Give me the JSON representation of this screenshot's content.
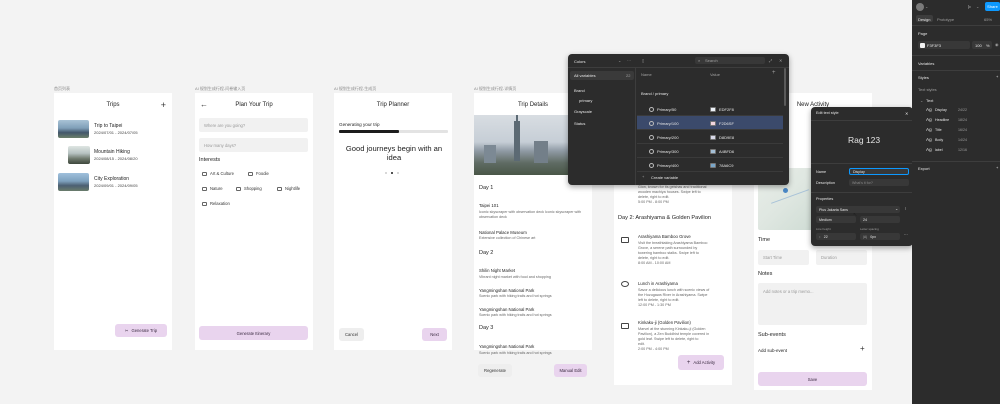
{
  "frame_labels": [
    "首页列表",
    "AI 规划生成行程-问卷输入页",
    "AI 规划生成行程-生成页",
    "AI 规划生成行程-详情页",
    "AI 规划生成行程-编辑页"
  ],
  "screen_trips": {
    "title": "Trips",
    "add_icon": "plus-icon",
    "trips": [
      {
        "name": "Trip to Taipei",
        "dates": "2024/07/01 - 2024/07/05"
      },
      {
        "name": "Mountain Hiking",
        "dates": "2024/08/15 - 2024/08/20"
      },
      {
        "name": "City Exploration",
        "dates": "2024/09/01 - 2024/09/05"
      }
    ],
    "generate_button": "Generate Trip"
  },
  "screen_plan": {
    "title": "Plan Your Trip",
    "destination_placeholder": "Where are you going?",
    "days_placeholder": "How many days?",
    "interests_heading": "Interests",
    "interests": [
      "Art & Culture",
      "Foodie",
      "Nature",
      "Shopping",
      "Nightlife",
      "Relaxation"
    ],
    "generate_button": "Generate Itinerary"
  },
  "screen_planner": {
    "title": "Trip Planner",
    "status": "Generating your trip",
    "progress": 0.55,
    "message": "Good journeys begin with an idea",
    "cancel_button": "Cancel",
    "next_button": "Next"
  },
  "screen_details": {
    "title": "Trip Details",
    "days": [
      {
        "label": "Day 1",
        "items": [
          {
            "title": "Taipei 101",
            "desc": "Iconic skyscraper with observation deck Iconic skyscraper with observation deck"
          },
          {
            "title": "National Palace Museum",
            "desc": "Extensive collection of Chinese art"
          }
        ]
      },
      {
        "label": "Day 2",
        "items": [
          {
            "title": "Shilin Night Market",
            "desc": "Vibrant night market with food and shopping"
          },
          {
            "title": "Yangmingshan National Park",
            "desc": "Scenic park with hiking trails and hot springs"
          },
          {
            "title": "Yangmingshan National Park",
            "desc": "Scenic park with hiking trails and hot springs"
          }
        ]
      },
      {
        "label": "Day 3",
        "items": [
          {
            "title": "Yangmingshan National Park",
            "desc": "Scenic park with hiking trails and hot springs"
          }
        ]
      }
    ],
    "regenerate_button": "Regenerate",
    "manual_edit_button": "Manual Edit"
  },
  "screen_edit": {
    "top_lines": [
      "Gion, known for its geishas and traditional",
      "wooden machiya houses. Swipe left to",
      "delete, right to edit.",
      "5:00 PM - 8:00 PM"
    ],
    "day2_heading": "Day 2: Arashiyama & Golden Pavilion",
    "activities": [
      {
        "icon": "forest-icon",
        "title": "Arashiyama Bamboo Grove",
        "lines": [
          "Visit the breathtaking Arashiyama Bamboo",
          "Grove, a serene path surrounded by",
          "towering bamboo stalks. Swipe left to",
          "delete, right to edit."
        ],
        "time": "8:00 AM - 10:00 AM"
      },
      {
        "icon": "restaurant-icon",
        "title": "Lunch in Arashiyama",
        "lines": [
          "Savor a delicious lunch with scenic views of",
          "the Hozugawa River in Arashiyama. Swipe",
          "left to delete, right to edit."
        ],
        "time": "12:00 PM - 1:30 PM"
      },
      {
        "icon": "temple-icon",
        "title": "Kinkaku-ji (Golden Pavilion)",
        "lines": [
          "Marvel at the stunning Kinkaku-ji (Golden",
          "Pavilion), a Zen Buddhist temple covered in",
          "gold leaf. Swipe left to delete, right to",
          "edit."
        ],
        "time": "2:00 PM - 4:00 PM"
      }
    ],
    "add_activity_button": "Add Activity"
  },
  "screen_new": {
    "title": "New Activity",
    "time_heading": "Time",
    "start_placeholder": "Start Time",
    "duration_placeholder": "Duration",
    "notes_heading": "Notes",
    "notes_placeholder": "Add notes or a trip memo...",
    "subevents_heading": "Sub-events",
    "add_subevent": "Add sub-event",
    "save_button": "Save"
  },
  "variables_panel": {
    "collection": "Colors",
    "search_placeholder": "Search",
    "side": {
      "all_label": "All variables",
      "all_count": "22",
      "groups": [
        "Brand",
        "primary",
        "Grayscale",
        "Status"
      ]
    },
    "col_name": "Name",
    "col_value": "Value",
    "path": "Brand / primary",
    "rows": [
      {
        "name": "Primary/50",
        "value": "EDF2F8",
        "color": "#EDF2F8",
        "selected": false
      },
      {
        "name": "Primary/100",
        "value": "F2D6SF",
        "color": "#F2D6DF",
        "selected": true
      },
      {
        "name": "Primary/200",
        "value": "D8D9E8",
        "color": "#D8D9E8",
        "selected": false
      },
      {
        "name": "Primary/300",
        "value": "A4BFD6",
        "color": "#A4BFD6",
        "selected": false
      },
      {
        "name": "Primary/400",
        "value": "78A6C9",
        "color": "#78A6C9",
        "selected": false
      }
    ],
    "create_label": "Create variable"
  },
  "text_style_popup": {
    "title": "Edit text style",
    "preview": "Rag 123",
    "name_label": "Name",
    "name_value": "Display",
    "description_label": "Description",
    "description_placeholder": "What's it for?",
    "properties_heading": "Properties",
    "font_family": "Plus Jakarta Sans",
    "font_weight": "Medium",
    "font_size": "24",
    "line_height_label": "Line height",
    "line_height_value": "22",
    "letter_spacing_label": "Letter spacing",
    "letter_spacing_value": "0px"
  },
  "right_sidebar": {
    "tabs": [
      "Design",
      "Prototype"
    ],
    "zoom": "65%",
    "share_button": "Share",
    "page_heading": "Page",
    "page_color": "F3F3F3",
    "page_opacity": "100",
    "page_opacity_unit": "%",
    "variables_heading": "Variables",
    "styles_heading": "Styles",
    "text_styles_heading": "Text styles",
    "text_group": "Text",
    "text_styles": [
      {
        "name": "Display",
        "spec": "24/22"
      },
      {
        "name": "Headline",
        "spec": "18/24"
      },
      {
        "name": "Title",
        "spec": "16/24"
      },
      {
        "name": "Body",
        "spec": "14/24"
      },
      {
        "name": "label",
        "spec": "12/16"
      }
    ],
    "export_heading": "Export",
    "accent": "#0d99ff"
  }
}
